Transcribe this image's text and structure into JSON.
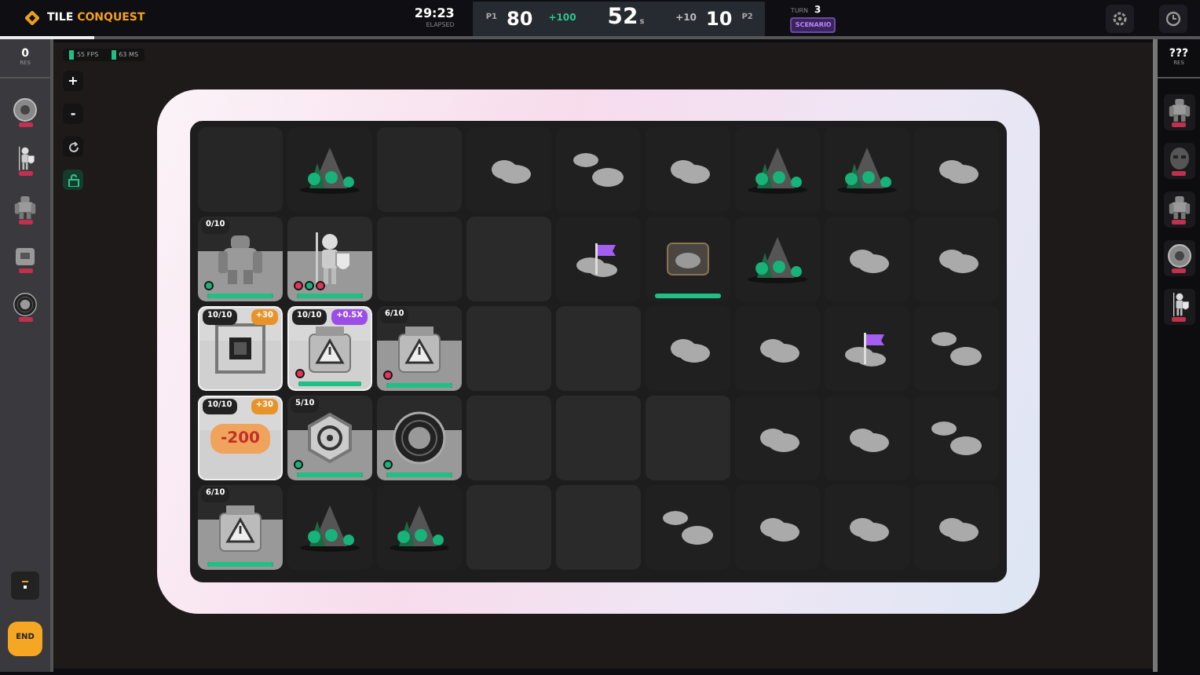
{
  "header": {
    "logo": "TILE",
    "logo_accent": "CONQUEST",
    "timer": "29:23",
    "timer_label": "ELAPSED",
    "p1_label": "P1",
    "p1_score": "80",
    "p1_gain": "+100",
    "countdown": "52",
    "countdown_unit": "s",
    "p2_gain": "+10",
    "p2_score": "10",
    "p2_label": "P2",
    "turn_label": "TURN",
    "turn": "3",
    "mode": "SCENARIO"
  },
  "left_panel": {
    "count": "0",
    "count_label": "RES",
    "units": [
      {
        "kind": "gear"
      },
      {
        "kind": "knight"
      },
      {
        "kind": "golem"
      },
      {
        "kind": "robot"
      },
      {
        "kind": "disk"
      }
    ],
    "end_button": "END"
  },
  "right_panel": {
    "count": "???",
    "count_label": "RES",
    "units": [
      {
        "kind": "golem"
      },
      {
        "kind": "mask"
      },
      {
        "kind": "golem"
      },
      {
        "kind": "gear"
      },
      {
        "kind": "knight"
      }
    ]
  },
  "stats": [
    "55 FPS",
    "63 MS"
  ],
  "tools": [
    {
      "label": "+",
      "kind": "text",
      "on": false
    },
    {
      "label": "-",
      "kind": "text",
      "on": false
    },
    {
      "kind": "reset",
      "on": false
    },
    {
      "kind": "lock",
      "on": true
    }
  ],
  "board": [
    [
      {
        "kind": "fog"
      },
      {
        "kind": "mountain"
      },
      {
        "kind": "fog"
      },
      {
        "kind": "cloud"
      },
      {
        "kind": "clouds"
      },
      {
        "kind": "cloud"
      },
      {
        "kind": "mountain"
      },
      {
        "kind": "mountain"
      },
      {
        "kind": "cloud"
      }
    ],
    [
      {
        "kind": "golem",
        "count": "0/10",
        "selected": false,
        "level": 1,
        "dots": [
          {
            "color": "#1fae7a"
          }
        ]
      },
      {
        "kind": "knight",
        "selected": false,
        "level": 1,
        "dots": [
          {
            "color": "#e0355a"
          },
          {
            "color": "#1fae7a"
          },
          {
            "color": "#e0355a"
          }
        ]
      },
      {
        "kind": "fog"
      },
      {
        "kind": "empty"
      },
      {
        "kind": "flag"
      },
      {
        "kind": "crate",
        "level": 1
      },
      {
        "kind": "mountain"
      },
      {
        "kind": "cloud"
      },
      {
        "kind": "cloud"
      }
    ],
    [
      {
        "kind": "chip",
        "count": "10/10",
        "bonus": "+30",
        "color": "#e8932a",
        "selected": true
      },
      {
        "kind": "hazard",
        "count": "10/10",
        "bonus": "+0.5X",
        "color": "#9b4de8",
        "selected": true,
        "level": 1,
        "dots": [
          {
            "color": "#e0355a"
          }
        ]
      },
      {
        "kind": "hazard",
        "count": "6/10",
        "selected": false,
        "level": 1,
        "dots": [
          {
            "color": "#e0355a"
          }
        ]
      },
      {
        "kind": "empty"
      },
      {
        "kind": "empty"
      },
      {
        "kind": "cloud"
      },
      {
        "kind": "cloud"
      },
      {
        "kind": "flag"
      },
      {
        "kind": "clouds"
      }
    ],
    [
      {
        "kind": "banner",
        "count": "10/10",
        "bonus": "+30",
        "color": "#e8932a",
        "text": "-200",
        "selected": true
      },
      {
        "kind": "biohazard",
        "count": "5/10",
        "selected": false,
        "level": 1,
        "dots": [
          {
            "color": "#1fae7a"
          }
        ]
      },
      {
        "kind": "disk",
        "selected": false,
        "level": 1,
        "dots": [
          {
            "color": "#1fae7a"
          }
        ]
      },
      {
        "kind": "empty"
      },
      {
        "kind": "empty"
      },
      {
        "kind": "empty"
      },
      {
        "kind": "cloud"
      },
      {
        "kind": "cloud"
      },
      {
        "kind": "clouds"
      }
    ],
    [
      {
        "kind": "hazard",
        "count": "6/10",
        "selected": false,
        "level": 1
      },
      {
        "kind": "mountain"
      },
      {
        "kind": "mountain"
      },
      {
        "kind": "empty"
      },
      {
        "kind": "empty"
      },
      {
        "kind": "clouds"
      },
      {
        "kind": "cloud"
      },
      {
        "kind": "cloud"
      },
      {
        "kind": "cloud"
      }
    ]
  ]
}
